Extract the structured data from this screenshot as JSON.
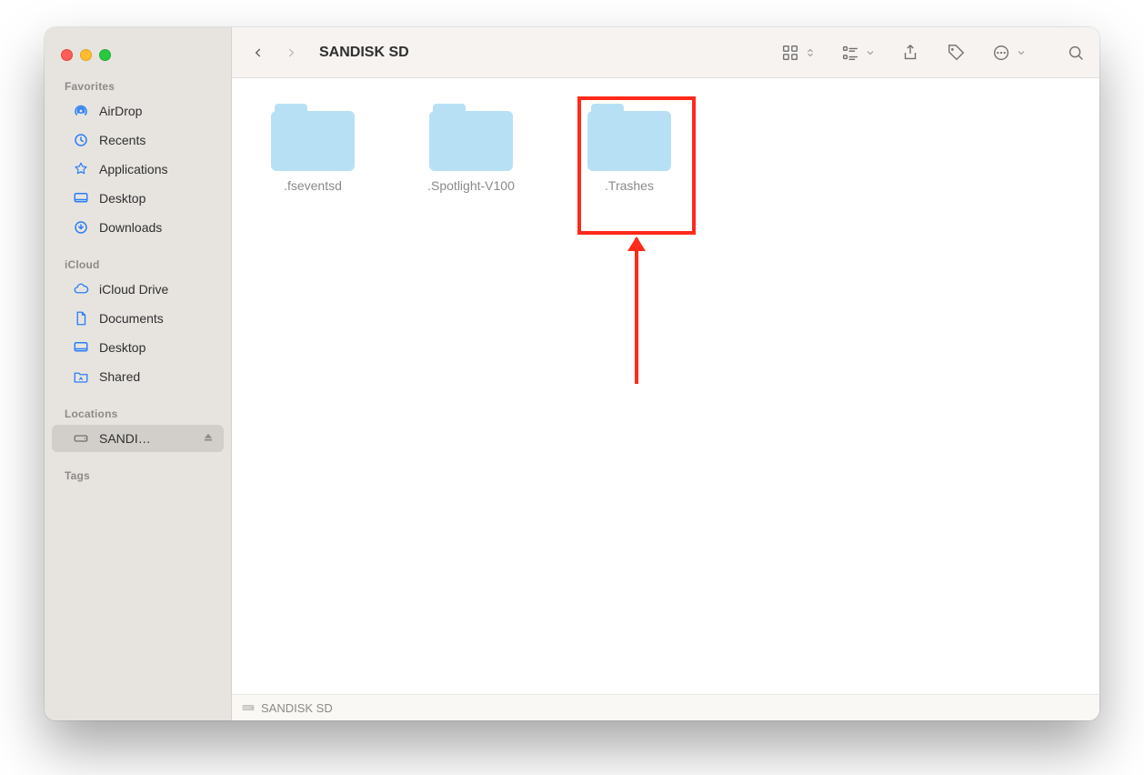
{
  "window_title": "SANDISK SD",
  "traffic_lights": {
    "close": "#ff5f57",
    "minimize": "#febc2e",
    "maximize": "#28c840"
  },
  "sidebar": {
    "sections": [
      {
        "label": "Favorites",
        "items": [
          {
            "label": "AirDrop",
            "icon": "airdrop-icon"
          },
          {
            "label": "Recents",
            "icon": "clock-icon"
          },
          {
            "label": "Applications",
            "icon": "applications-icon"
          },
          {
            "label": "Desktop",
            "icon": "desktop-icon"
          },
          {
            "label": "Downloads",
            "icon": "downloads-icon"
          }
        ]
      },
      {
        "label": "iCloud",
        "items": [
          {
            "label": "iCloud Drive",
            "icon": "cloud-icon"
          },
          {
            "label": "Documents",
            "icon": "document-icon"
          },
          {
            "label": "Desktop",
            "icon": "desktop-icon"
          },
          {
            "label": "Shared",
            "icon": "shared-folder-icon"
          }
        ]
      },
      {
        "label": "Locations",
        "items": [
          {
            "label": "SANDI…",
            "icon": "drive-icon",
            "selected": true,
            "ejectable": true
          }
        ]
      },
      {
        "label": "Tags",
        "items": []
      }
    ]
  },
  "toolbar": {
    "back_enabled": true,
    "forward_enabled": false,
    "title": "SANDISK SD",
    "icons": [
      "icon-view-switch",
      "group-by",
      "share",
      "tag",
      "more-actions",
      "search"
    ]
  },
  "content": {
    "folders": [
      {
        "name": ".fseventsd"
      },
      {
        "name": ".Spotlight-V100"
      },
      {
        "name": ".Trashes"
      }
    ],
    "highlighted_index": 2
  },
  "pathbar": {
    "items": [
      {
        "label": "SANDISK SD",
        "icon": "drive-icon"
      }
    ]
  },
  "annotation": {
    "highlight_color": "#ff2a1a"
  }
}
